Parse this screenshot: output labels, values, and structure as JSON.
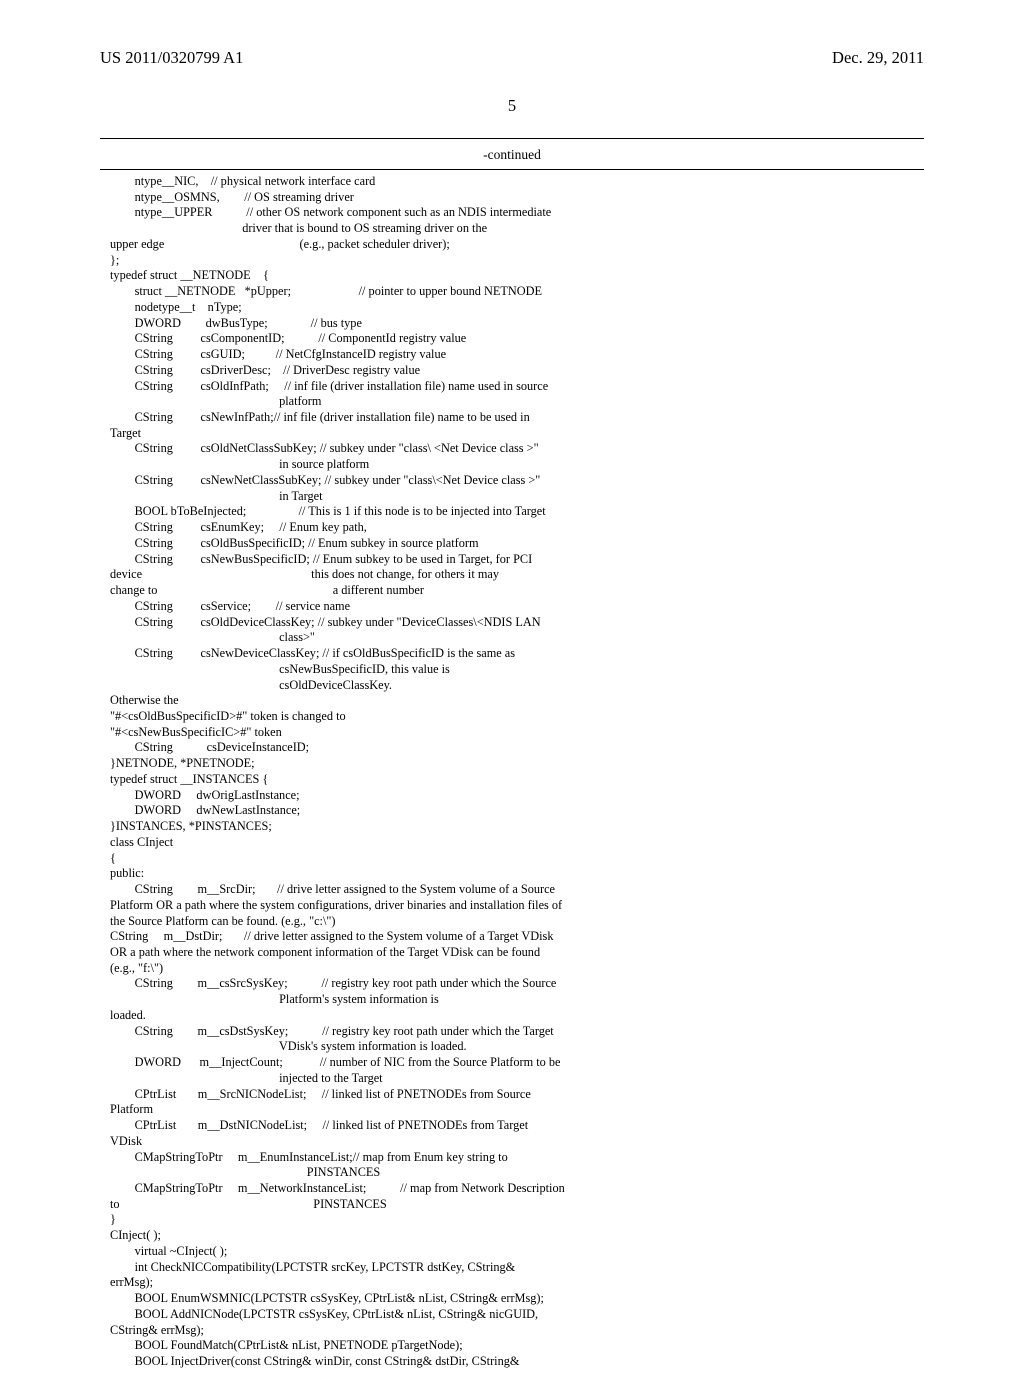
{
  "header": {
    "publication": "US 2011/0320799 A1",
    "date": "Dec. 29, 2011"
  },
  "page_number": "5",
  "section": "-continued",
  "code": "        ntype__NIC,    // physical network interface card\n        ntype__OSMNS,        // OS streaming driver\n        ntype__UPPER           // other OS network component such as an NDIS intermediate\n                                           driver that is bound to OS streaming driver on the\nupper edge                                            (e.g., packet scheduler driver);\n};\ntypedef struct __NETNODE    {\n        struct __NETNODE   *pUpper;                      // pointer to upper bound NETNODE\n        nodetype__t    nType;\n        DWORD        dwBusType;              // bus type\n        CString         csComponentID;           // ComponentId registry value\n        CString         csGUID;          // NetCfgInstanceID registry value\n        CString         csDriverDesc;    // DriverDesc registry value\n        CString         csOldInfPath;     // inf file (driver installation file) name used in source\n                                                       platform\n        CString         csNewInfPath;// inf file (driver installation file) name to be used in\nTarget\n        CString         csOldNetClassSubKey; // subkey under \"class\\ <Net Device class >\"\n                                                       in source platform\n        CString         csNewNetClassSubKey; // subkey under \"class\\<Net Device class >\"\n                                                       in Target\n        BOOL bToBeInjected;                 // This is 1 if this node is to be injected into Target\n        CString         csEnumKey;     // Enum key path,\n        CString         csOldBusSpecificID; // Enum subkey in source platform\n        CString         csNewBusSpecificID; // Enum subkey to be used in Target, for PCI\ndevice                                                       this does not change, for others it may\nchange to                                                         a different number\n        CString         csService;        // service name\n        CString         csOldDeviceClassKey; // subkey under \"DeviceClasses\\<NDIS LAN\n                                                       class>\"\n        CString         csNewDeviceClassKey; // if csOldBusSpecificID is the same as\n                                                       csNewBusSpecificID, this value is\n                                                       csOldDeviceClassKey.\nOtherwise the\n\"#<csOldBusSpecificID>#\" token is changed to\n\"#<csNewBusSpecificIC>#\" token\n        CString           csDeviceInstanceID;\n}NETNODE, *PNETNODE;\ntypedef struct __INSTANCES {\n        DWORD     dwOrigLastInstance;\n        DWORD     dwNewLastInstance;\n}INSTANCES, *PINSTANCES;\nclass CInject\n{\npublic:\n        CString        m__SrcDir;       // drive letter assigned to the System volume of a Source\nPlatform OR a path where the system configurations, driver binaries and installation files of\nthe Source Platform can be found. (e.g., \"c:\\\")\nCString     m__DstDir;       // drive letter assigned to the System volume of a Target VDisk\nOR a path where the network component information of the Target VDisk can be found\n(e.g., \"f:\\\")\n        CString        m__csSrcSysKey;           // registry key root path under which the Source\n                                                       Platform's system information is\nloaded.\n        CString        m__csDstSysKey;           // registry key root path under which the Target\n                                                       VDisk's system information is loaded.\n        DWORD      m__InjectCount;            // number of NIC from the Source Platform to be\n                                                       injected to the Target\n        CPtrList       m__SrcNICNodeList;     // linked list of PNETNODEs from Source\nPlatform\n        CPtrList       m__DstNICNodeList;     // linked list of PNETNODEs from Target\nVDisk\n        CMapStringToPtr     m__EnumInstanceList;// map from Enum key string to\n                                                                PINSTANCES\n        CMapStringToPtr     m__NetworkInstanceList;           // map from Network Description\nto                                                               PINSTANCES\n}\nCInject( );\n        virtual ~CInject( );\n        int CheckNICCompatibility(LPCTSTR srcKey, LPCTSTR dstKey, CString&\nerrMsg);\n        BOOL EnumWSMNIC(LPCTSTR csSysKey, CPtrList& nList, CString& errMsg);\n        BOOL AddNICNode(LPCTSTR csSysKey, CPtrList& nList, CString& nicGUID,\nCString& errMsg);\n        BOOL FoundMatch(CPtrList& nList, PNETNODE pTargetNode);\n        BOOL InjectDriver(const CString& winDir, const CString& dstDir, CString&"
}
